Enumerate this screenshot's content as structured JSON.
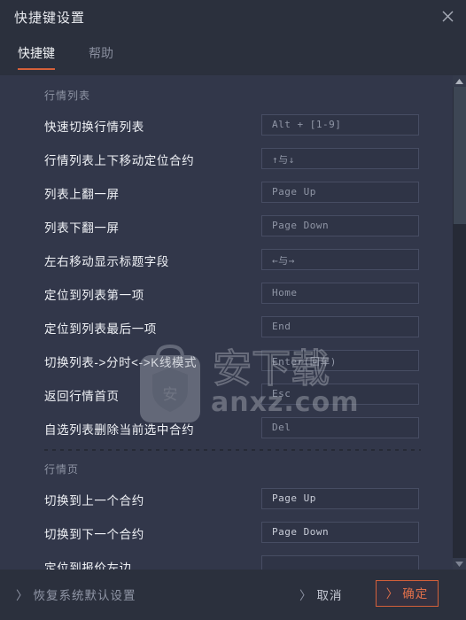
{
  "window": {
    "title": "快捷键设置",
    "close_icon": "close-icon"
  },
  "tabs": [
    {
      "label": "快捷键",
      "active": true
    },
    {
      "label": "帮助",
      "active": false
    }
  ],
  "sections": [
    {
      "title": "行情列表",
      "rows": [
        {
          "label": "快速切换行情列表",
          "value": "Alt + [1-9]"
        },
        {
          "label": "行情列表上下移动定位合约",
          "value": "↑与↓"
        },
        {
          "label": "列表上翻一屏",
          "value": "Page Up"
        },
        {
          "label": "列表下翻一屏",
          "value": "Page Down"
        },
        {
          "label": "左右移动显示标题字段",
          "value": "←与→"
        },
        {
          "label": "定位到列表第一项",
          "value": "Home"
        },
        {
          "label": "定位到列表最后一项",
          "value": "End"
        },
        {
          "label": "切换列表->分时<->K线模式",
          "value": "Enter(回车)"
        },
        {
          "label": "返回行情首页",
          "value": "Esc"
        },
        {
          "label": "自选列表删除当前选中合约",
          "value": "Del"
        }
      ]
    },
    {
      "title": "行情页",
      "rows": [
        {
          "label": "切换到上一个合约",
          "value": "Page Up"
        },
        {
          "label": "切换到下一个合约",
          "value": "Page Down"
        },
        {
          "label": "定位到报价左边",
          "value": ""
        }
      ]
    }
  ],
  "footer": {
    "restore_label": "恢复系统默认设置",
    "cancel_label": "取消",
    "confirm_label": "确定",
    "chevron": "〉"
  },
  "scrollbar": {
    "up_icon": "scroll-up-arrow-icon",
    "down_icon": "scroll-down-arrow-icon"
  },
  "watermark": {
    "text": "anxz.com",
    "logo_char": "安"
  },
  "colors": {
    "accent": "#d4603a",
    "window_bg": "#32374a",
    "bar_bg": "#2b303d",
    "input_bg": "#2f3446",
    "input_border": "#474d63",
    "label": "#f0f2f6",
    "muted": "#8d93a3"
  }
}
